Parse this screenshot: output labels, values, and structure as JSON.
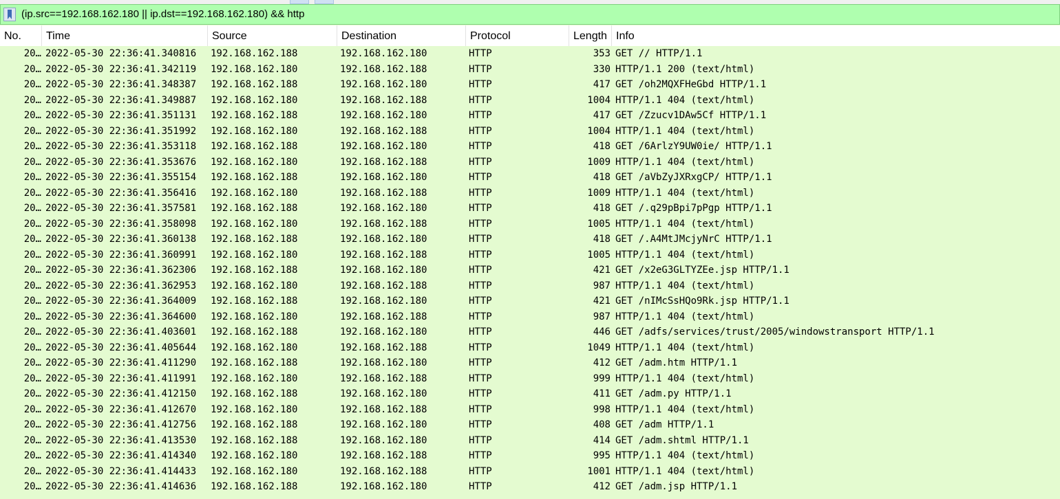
{
  "filter": {
    "text": "(ip.src==192.168.162.180 || ip.dst==192.168.162.180) && http"
  },
  "columns": [
    "No.",
    "Time",
    "Source",
    "Destination",
    "Protocol",
    "Length",
    "Info"
  ],
  "rows": [
    {
      "no": "20…",
      "time": "2022-05-30 22:36:41.340816",
      "src": "192.168.162.188",
      "dst": "192.168.162.180",
      "proto": "HTTP",
      "len": "353",
      "info": "GET // HTTP/1.1"
    },
    {
      "no": "20…",
      "time": "2022-05-30 22:36:41.342119",
      "src": "192.168.162.180",
      "dst": "192.168.162.188",
      "proto": "HTTP",
      "len": "330",
      "info": "HTTP/1.1 200   (text/html)"
    },
    {
      "no": "20…",
      "time": "2022-05-30 22:36:41.348387",
      "src": "192.168.162.188",
      "dst": "192.168.162.180",
      "proto": "HTTP",
      "len": "417",
      "info": "GET /oh2MQXFHeGbd HTTP/1.1"
    },
    {
      "no": "20…",
      "time": "2022-05-30 22:36:41.349887",
      "src": "192.168.162.180",
      "dst": "192.168.162.188",
      "proto": "HTTP",
      "len": "1004",
      "info": "HTTP/1.1 404   (text/html)"
    },
    {
      "no": "20…",
      "time": "2022-05-30 22:36:41.351131",
      "src": "192.168.162.188",
      "dst": "192.168.162.180",
      "proto": "HTTP",
      "len": "417",
      "info": "GET /Zzucv1DAw5Cf HTTP/1.1"
    },
    {
      "no": "20…",
      "time": "2022-05-30 22:36:41.351992",
      "src": "192.168.162.180",
      "dst": "192.168.162.188",
      "proto": "HTTP",
      "len": "1004",
      "info": "HTTP/1.1 404   (text/html)"
    },
    {
      "no": "20…",
      "time": "2022-05-30 22:36:41.353118",
      "src": "192.168.162.188",
      "dst": "192.168.162.180",
      "proto": "HTTP",
      "len": "418",
      "info": "GET /6ArlzY9UW0ie/ HTTP/1.1"
    },
    {
      "no": "20…",
      "time": "2022-05-30 22:36:41.353676",
      "src": "192.168.162.180",
      "dst": "192.168.162.188",
      "proto": "HTTP",
      "len": "1009",
      "info": "HTTP/1.1 404   (text/html)"
    },
    {
      "no": "20…",
      "time": "2022-05-30 22:36:41.355154",
      "src": "192.168.162.188",
      "dst": "192.168.162.180",
      "proto": "HTTP",
      "len": "418",
      "info": "GET /aVbZyJXRxgCP/ HTTP/1.1"
    },
    {
      "no": "20…",
      "time": "2022-05-30 22:36:41.356416",
      "src": "192.168.162.180",
      "dst": "192.168.162.188",
      "proto": "HTTP",
      "len": "1009",
      "info": "HTTP/1.1 404   (text/html)"
    },
    {
      "no": "20…",
      "time": "2022-05-30 22:36:41.357581",
      "src": "192.168.162.188",
      "dst": "192.168.162.180",
      "proto": "HTTP",
      "len": "418",
      "info": "GET /.q29pBpi7pPgp HTTP/1.1"
    },
    {
      "no": "20…",
      "time": "2022-05-30 22:36:41.358098",
      "src": "192.168.162.180",
      "dst": "192.168.162.188",
      "proto": "HTTP",
      "len": "1005",
      "info": "HTTP/1.1 404   (text/html)"
    },
    {
      "no": "20…",
      "time": "2022-05-30 22:36:41.360138",
      "src": "192.168.162.188",
      "dst": "192.168.162.180",
      "proto": "HTTP",
      "len": "418",
      "info": "GET /.A4MtJMcjyNrC HTTP/1.1"
    },
    {
      "no": "20…",
      "time": "2022-05-30 22:36:41.360991",
      "src": "192.168.162.180",
      "dst": "192.168.162.188",
      "proto": "HTTP",
      "len": "1005",
      "info": "HTTP/1.1 404   (text/html)"
    },
    {
      "no": "20…",
      "time": "2022-05-30 22:36:41.362306",
      "src": "192.168.162.188",
      "dst": "192.168.162.180",
      "proto": "HTTP",
      "len": "421",
      "info": "GET /x2eG3GLTYZEe.jsp HTTP/1.1"
    },
    {
      "no": "20…",
      "time": "2022-05-30 22:36:41.362953",
      "src": "192.168.162.180",
      "dst": "192.168.162.188",
      "proto": "HTTP",
      "len": "987",
      "info": "HTTP/1.1 404   (text/html)"
    },
    {
      "no": "20…",
      "time": "2022-05-30 22:36:41.364009",
      "src": "192.168.162.188",
      "dst": "192.168.162.180",
      "proto": "HTTP",
      "len": "421",
      "info": "GET /nIMcSsHQo9Rk.jsp HTTP/1.1"
    },
    {
      "no": "20…",
      "time": "2022-05-30 22:36:41.364600",
      "src": "192.168.162.180",
      "dst": "192.168.162.188",
      "proto": "HTTP",
      "len": "987",
      "info": "HTTP/1.1 404   (text/html)"
    },
    {
      "no": "20…",
      "time": "2022-05-30 22:36:41.403601",
      "src": "192.168.162.188",
      "dst": "192.168.162.180",
      "proto": "HTTP",
      "len": "446",
      "info": "GET /adfs/services/trust/2005/windowstransport HTTP/1.1"
    },
    {
      "no": "20…",
      "time": "2022-05-30 22:36:41.405644",
      "src": "192.168.162.180",
      "dst": "192.168.162.188",
      "proto": "HTTP",
      "len": "1049",
      "info": "HTTP/1.1 404   (text/html)"
    },
    {
      "no": "20…",
      "time": "2022-05-30 22:36:41.411290",
      "src": "192.168.162.188",
      "dst": "192.168.162.180",
      "proto": "HTTP",
      "len": "412",
      "info": "GET /adm.htm HTTP/1.1"
    },
    {
      "no": "20…",
      "time": "2022-05-30 22:36:41.411991",
      "src": "192.168.162.180",
      "dst": "192.168.162.188",
      "proto": "HTTP",
      "len": "999",
      "info": "HTTP/1.1 404   (text/html)"
    },
    {
      "no": "20…",
      "time": "2022-05-30 22:36:41.412150",
      "src": "192.168.162.188",
      "dst": "192.168.162.180",
      "proto": "HTTP",
      "len": "411",
      "info": "GET /adm.py HTTP/1.1"
    },
    {
      "no": "20…",
      "time": "2022-05-30 22:36:41.412670",
      "src": "192.168.162.180",
      "dst": "192.168.162.188",
      "proto": "HTTP",
      "len": "998",
      "info": "HTTP/1.1 404   (text/html)"
    },
    {
      "no": "20…",
      "time": "2022-05-30 22:36:41.412756",
      "src": "192.168.162.188",
      "dst": "192.168.162.180",
      "proto": "HTTP",
      "len": "408",
      "info": "GET /adm HTTP/1.1"
    },
    {
      "no": "20…",
      "time": "2022-05-30 22:36:41.413530",
      "src": "192.168.162.188",
      "dst": "192.168.162.180",
      "proto": "HTTP",
      "len": "414",
      "info": "GET /adm.shtml HTTP/1.1"
    },
    {
      "no": "20…",
      "time": "2022-05-30 22:36:41.414340",
      "src": "192.168.162.180",
      "dst": "192.168.162.188",
      "proto": "HTTP",
      "len": "995",
      "info": "HTTP/1.1 404   (text/html)"
    },
    {
      "no": "20…",
      "time": "2022-05-30 22:36:41.414433",
      "src": "192.168.162.180",
      "dst": "192.168.162.188",
      "proto": "HTTP",
      "len": "1001",
      "info": "HTTP/1.1 404   (text/html)"
    },
    {
      "no": "20…",
      "time": "2022-05-30 22:36:41.414636",
      "src": "192.168.162.188",
      "dst": "192.168.162.180",
      "proto": "HTTP",
      "len": "412",
      "info": "GET /adm.jsp HTTP/1.1"
    }
  ]
}
